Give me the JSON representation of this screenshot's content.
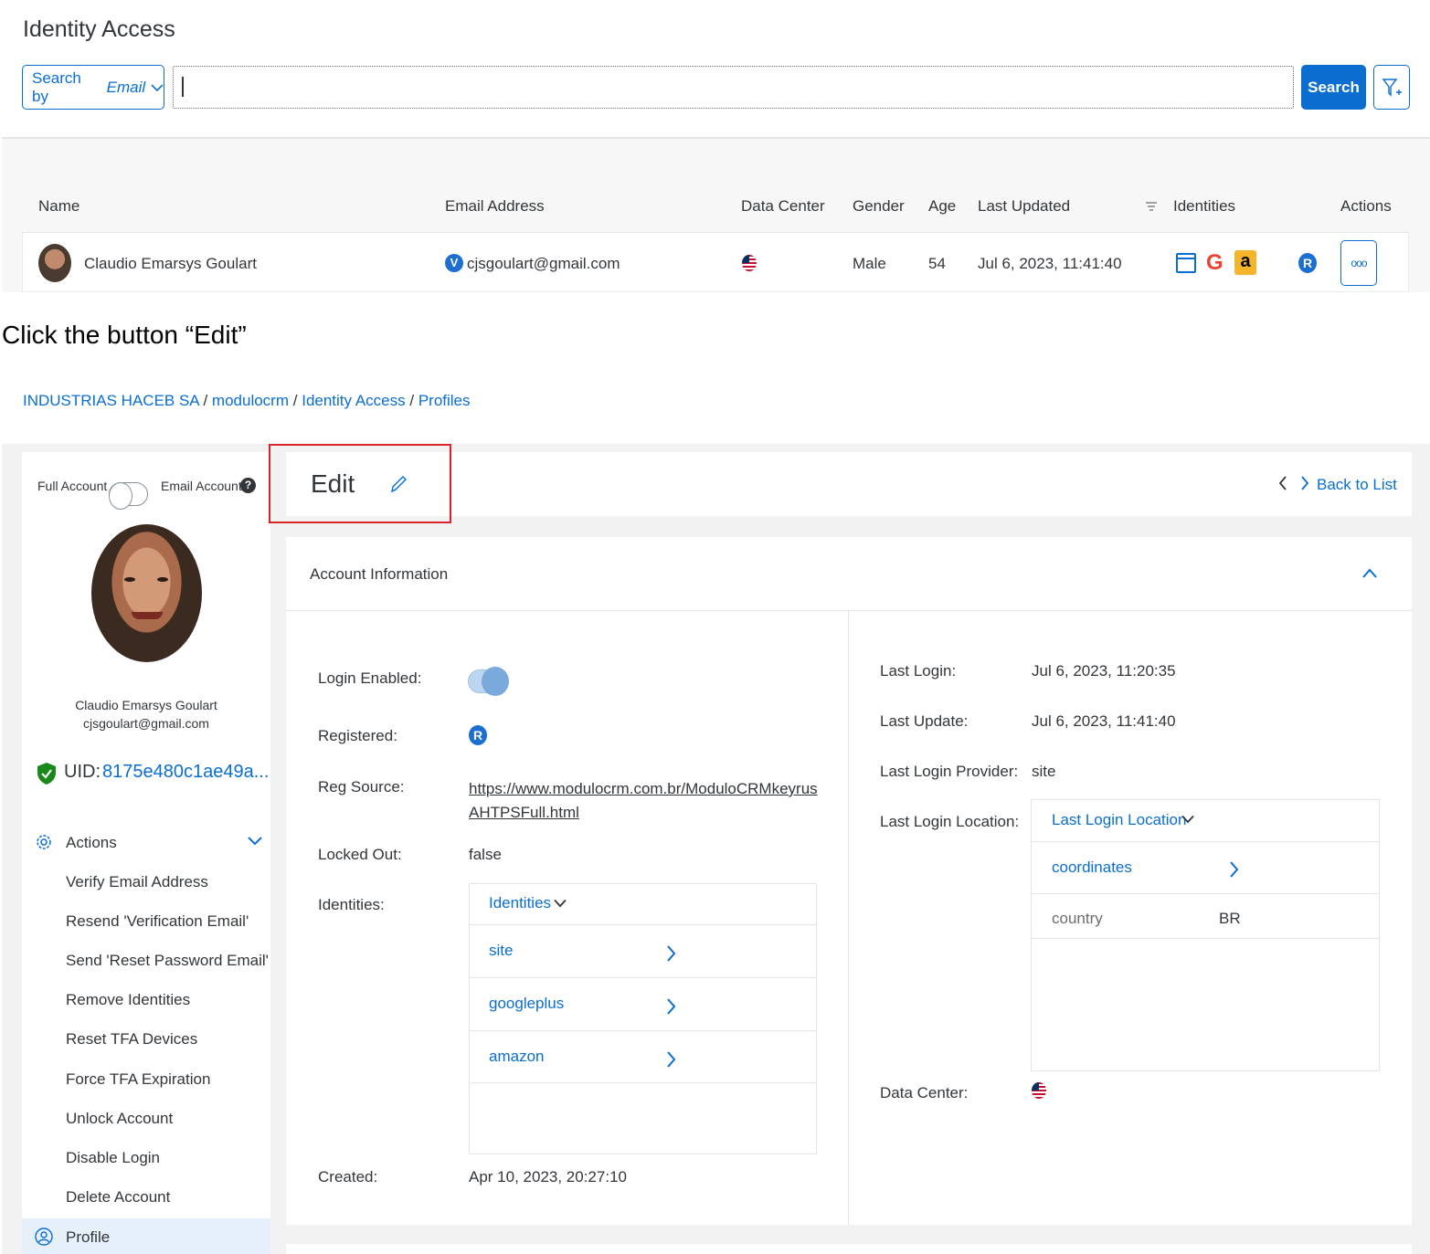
{
  "top": {
    "page_title": "Identity Access",
    "search_by": {
      "prefix": "Search by",
      "field": "Email"
    },
    "search_button": "Search",
    "table": {
      "headers": {
        "name": "Name",
        "email": "Email Address",
        "data_center": "Data Center",
        "gender": "Gender",
        "age": "Age",
        "last_updated": "Last Updated",
        "identities": "Identities",
        "actions": "Actions"
      },
      "row": {
        "name": "Claudio Emarsys Goulart",
        "email_badge": "V",
        "email": "cjsgoulart@gmail.com",
        "gender": "Male",
        "age": "54",
        "last_updated": "Jul 6, 2023, 11:41:40",
        "amazon_letter": "a",
        "google_letter": "G",
        "reg_badge": "R",
        "more": "ooo"
      }
    }
  },
  "instruction": "Click the button “Edit”",
  "breadcrumb": [
    "INDUSTRIAS HACEB SA",
    "modulocrm",
    "Identity Access",
    "Profiles"
  ],
  "breadcrumb_sep": "/",
  "left_panel": {
    "full_account": "Full Account",
    "email_account": "Email Account",
    "help": "?",
    "name": "Claudio Emarsys Goulart",
    "email": "cjsgoulart@gmail.com",
    "uid_label": "UID:",
    "uid_value": "8175e480c1ae49a...",
    "actions_title": "Actions",
    "actions": [
      "Verify Email Address",
      "Resend 'Verification Email'",
      "Send 'Reset Password Email'",
      "Remove Identities",
      "Reset TFA Devices",
      "Force TFA Expiration",
      "Unlock Account",
      "Disable Login",
      "Delete Account"
    ],
    "profile": "Profile"
  },
  "header": {
    "edit": "Edit",
    "back_to_list": "Back to List"
  },
  "account_info": {
    "title": "Account Information",
    "left": {
      "login_enabled": "Login Enabled:",
      "registered": "Registered:",
      "registered_badge": "R",
      "reg_source": "Reg Source:",
      "reg_source_value": "https://www.modulocrm.com.br/ModuloCRMkeyrusAHTPSFull.html",
      "locked_out": "Locked Out:",
      "locked_out_value": "false",
      "identities": "Identities:",
      "identities_header": "Identities",
      "identity_items": [
        "site",
        "googleplus",
        "amazon"
      ],
      "created": "Created:",
      "created_value": "Apr 10, 2023, 20:27:10"
    },
    "right": {
      "last_login": "Last Login:",
      "last_login_value": "Jul 6, 2023, 11:20:35",
      "last_update": "Last Update:",
      "last_update_value": "Jul 6, 2023, 11:41:40",
      "last_login_provider": "Last Login Provider:",
      "last_login_provider_value": "site",
      "last_login_location": "Last Login Location:",
      "location_header": "Last Login Location",
      "coordinates": "coordinates",
      "country_label": "country",
      "country_value": "BR",
      "data_center": "Data Center:"
    }
  },
  "colors": {
    "accent": "#0a6ed1",
    "highlight": "#d9252a"
  }
}
